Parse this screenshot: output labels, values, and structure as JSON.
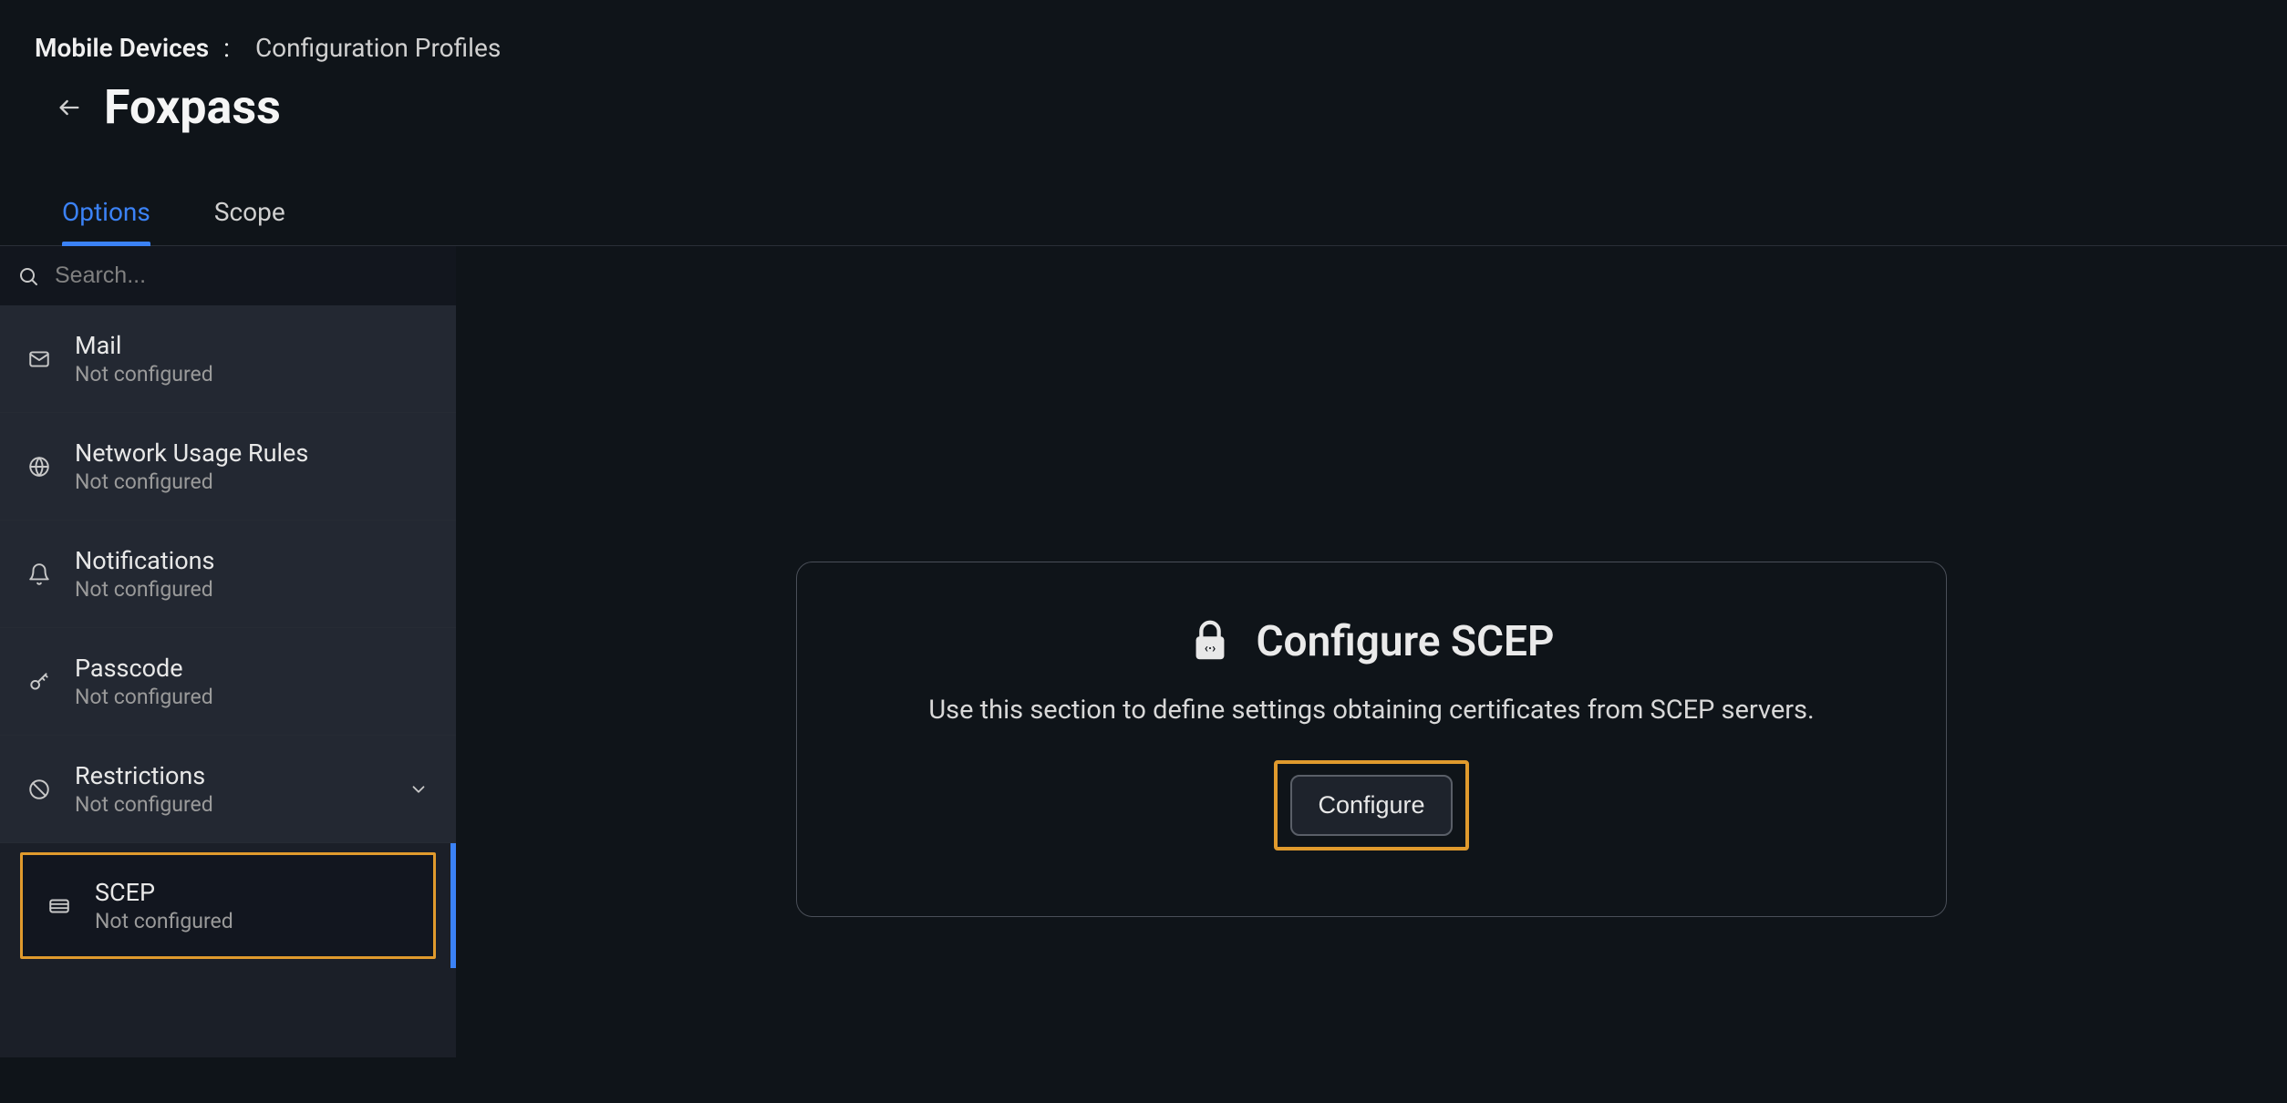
{
  "breadcrumb": {
    "root": "Mobile Devices",
    "separator": ":",
    "leaf": "Configuration Profiles"
  },
  "page": {
    "title": "Foxpass"
  },
  "tabs": [
    {
      "label": "Options",
      "active": true
    },
    {
      "label": "Scope",
      "active": false
    }
  ],
  "search": {
    "placeholder": "Search..."
  },
  "sidebar": {
    "items": [
      {
        "title": "Mail",
        "sub": "Not configured",
        "icon": "mail-icon",
        "selected": false,
        "expandable": false
      },
      {
        "title": "Network Usage Rules",
        "sub": "Not configured",
        "icon": "globe-icon",
        "selected": false,
        "expandable": false
      },
      {
        "title": "Notifications",
        "sub": "Not configured",
        "icon": "bell-icon",
        "selected": false,
        "expandable": false
      },
      {
        "title": "Passcode",
        "sub": "Not configured",
        "icon": "key-icon",
        "selected": false,
        "expandable": false
      },
      {
        "title": "Restrictions",
        "sub": "Not configured",
        "icon": "block-icon",
        "selected": false,
        "expandable": true
      },
      {
        "title": "SCEP",
        "sub": "Not configured",
        "icon": "card-icon",
        "selected": true,
        "expandable": false
      }
    ]
  },
  "main": {
    "card_title": "Configure SCEP",
    "card_desc": "Use this section to define settings obtaining certificates from SCEP servers.",
    "configure_label": "Configure"
  },
  "colors": {
    "accent": "#3b82f6",
    "highlight_border": "#e09a2d",
    "bg": "#0f1419",
    "sidebar_bg": "#1b1f28"
  }
}
